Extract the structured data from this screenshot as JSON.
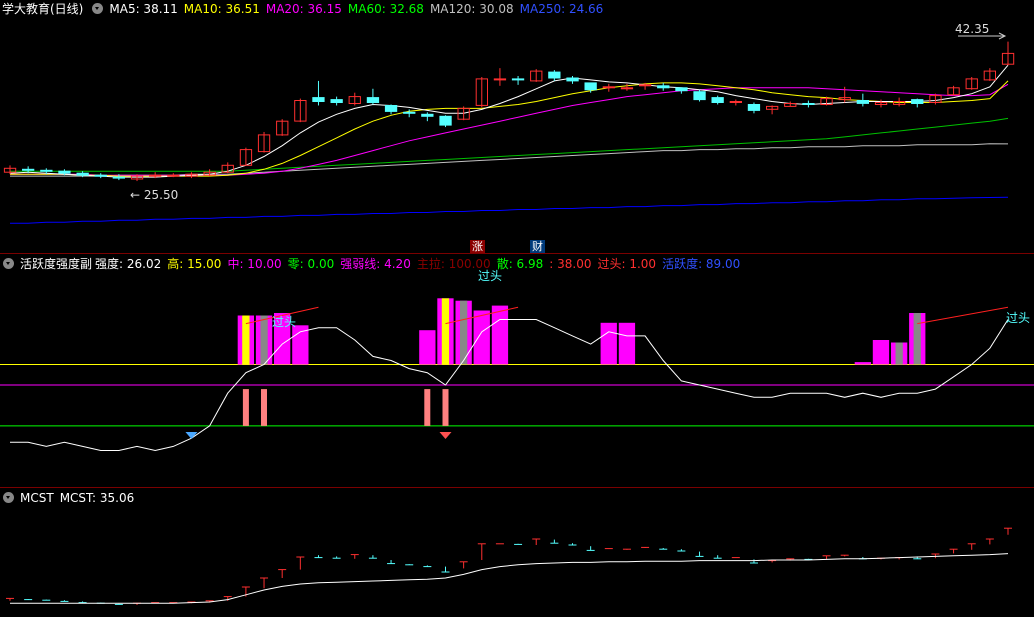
{
  "main": {
    "title": "学大教育(日线)",
    "ma": [
      {
        "label": "MA5: 38.11",
        "color": "#ffffff"
      },
      {
        "label": "MA10: 36.51",
        "color": "#ffff00"
      },
      {
        "label": "MA20: 36.15",
        "color": "#ff00ff"
      },
      {
        "label": "MA60: 32.68",
        "color": "#00ff00"
      },
      {
        "label": "MA120: 30.08",
        "color": "#c0c0c0"
      },
      {
        "label": "MA250: 24.66",
        "color": "#0000ff"
      }
    ],
    "high_label": "42.35",
    "low_label": "← 25.50",
    "badge_zhang": "涨",
    "badge_cai": "财"
  },
  "mid": {
    "title": "活跃度强度副",
    "fields": [
      {
        "label": "强度: 26.02",
        "color": "#ffffff"
      },
      {
        "label": "高: 15.00",
        "color": "#ffff00"
      },
      {
        "label": "中: 10.00",
        "color": "#ff00ff"
      },
      {
        "label": "零: 0.00",
        "color": "#00ff00"
      },
      {
        "label": "强弱线: 4.20",
        "color": "#ff00ff"
      },
      {
        "label": "主拉: 100.00",
        "color": "#8b0000"
      },
      {
        "label": "散: 6.98",
        "color": "#00ff00"
      },
      {
        "label": ": 38.00",
        "color": "#ff3030"
      },
      {
        "label": "过头: 1.00",
        "color": "#ff3030"
      },
      {
        "label": "活跃度: 89.00",
        "color": "#0000ff"
      }
    ],
    "guotou_labels": [
      "过头",
      "过头",
      "过头"
    ]
  },
  "bottom": {
    "title": "MCST",
    "value_label": "MCST: 35.06"
  },
  "colors": {
    "up": "#ff3030",
    "down": "#54ffff",
    "ma5": "#ffffff",
    "ma10": "#ffff00",
    "ma20": "#ff00ff",
    "ma60": "#00c000",
    "ma120": "#c0c0c0",
    "ma250": "#0000ff",
    "bar": "#ff00ff",
    "sep": "#7a0000"
  },
  "chart_data": {
    "type": "candlestick",
    "price_range": [
      25.5,
      42.35
    ],
    "candles": [
      [
        27.2,
        27.6,
        27.9,
        27.0
      ],
      [
        27.5,
        27.4,
        27.8,
        27.1
      ],
      [
        27.4,
        27.3,
        27.6,
        27.0
      ],
      [
        27.3,
        27.1,
        27.5,
        26.9
      ],
      [
        27.1,
        26.9,
        27.3,
        26.7
      ],
      [
        26.9,
        26.8,
        27.1,
        26.6
      ],
      [
        26.7,
        26.6,
        27.0,
        26.4
      ],
      [
        26.5,
        26.8,
        27.0,
        26.3
      ],
      [
        26.8,
        26.9,
        27.2,
        26.6
      ],
      [
        26.9,
        26.9,
        27.1,
        26.7
      ],
      [
        26.8,
        27.0,
        27.2,
        26.6
      ],
      [
        26.9,
        27.2,
        27.5,
        26.8
      ],
      [
        27.2,
        27.9,
        28.2,
        27.1
      ],
      [
        27.9,
        29.5,
        29.7,
        27.9
      ],
      [
        29.3,
        31.0,
        31.3,
        29.2
      ],
      [
        31.0,
        32.4,
        32.6,
        30.9
      ],
      [
        32.4,
        34.5,
        34.7,
        32.3
      ],
      [
        34.8,
        34.4,
        36.5,
        34.0
      ],
      [
        34.6,
        34.3,
        34.9,
        34.0
      ],
      [
        34.2,
        34.9,
        35.3,
        34.0
      ],
      [
        34.8,
        34.3,
        35.7,
        34.1
      ],
      [
        34.0,
        33.4,
        34.1,
        33.1
      ],
      [
        33.3,
        33.2,
        33.6,
        32.8
      ],
      [
        33.1,
        32.9,
        33.3,
        32.4
      ],
      [
        32.9,
        32.0,
        33.0,
        31.8
      ],
      [
        32.6,
        33.7,
        33.9,
        32.5
      ],
      [
        34.0,
        36.7,
        36.9,
        33.8
      ],
      [
        36.7,
        36.7,
        37.8,
        36.0
      ],
      [
        36.7,
        36.6,
        37.0,
        36.1
      ],
      [
        36.5,
        37.5,
        37.7,
        36.4
      ],
      [
        37.4,
        36.8,
        37.6,
        36.5
      ],
      [
        36.8,
        36.5,
        37.0,
        36.2
      ],
      [
        36.3,
        35.6,
        36.3,
        35.3
      ],
      [
        35.9,
        35.9,
        36.2,
        35.4
      ],
      [
        35.7,
        35.8,
        36.2,
        35.5
      ],
      [
        36.0,
        36.1,
        36.3,
        35.6
      ],
      [
        36.0,
        35.8,
        36.3,
        35.5
      ],
      [
        35.8,
        35.5,
        35.8,
        35.2
      ],
      [
        35.4,
        34.6,
        35.6,
        34.4
      ],
      [
        34.8,
        34.3,
        35.0,
        34.1
      ],
      [
        34.4,
        34.4,
        34.6,
        34.0
      ],
      [
        34.1,
        33.5,
        34.3,
        33.2
      ],
      [
        33.6,
        33.9,
        34.0,
        33.1
      ],
      [
        33.9,
        34.2,
        34.4,
        33.9
      ],
      [
        34.2,
        34.1,
        34.5,
        33.8
      ],
      [
        34.1,
        34.7,
        34.9,
        34.0
      ],
      [
        34.6,
        34.8,
        35.9,
        34.3
      ],
      [
        34.5,
        34.2,
        35.2,
        33.9
      ],
      [
        34.1,
        34.3,
        34.6,
        33.8
      ],
      [
        34.1,
        34.4,
        34.8,
        33.9
      ],
      [
        34.6,
        34.2,
        34.7,
        33.8
      ],
      [
        34.3,
        35.0,
        35.2,
        34.1
      ],
      [
        35.1,
        35.8,
        36.0,
        35.0
      ],
      [
        35.7,
        36.7,
        36.9,
        35.6
      ],
      [
        36.6,
        37.5,
        37.8,
        36.5
      ],
      [
        38.2,
        39.3,
        40.5,
        38.1
      ]
    ],
    "ma5": [
      27.1,
      27.2,
      27.1,
      27.0,
      26.9,
      26.8,
      26.7,
      26.7,
      26.7,
      26.8,
      26.9,
      27.0,
      27.3,
      27.9,
      28.8,
      29.9,
      31.2,
      32.3,
      33.1,
      33.7,
      34.1,
      34.0,
      33.8,
      33.5,
      33.2,
      33.2,
      33.6,
      34.2,
      34.9,
      35.7,
      36.5,
      36.8,
      36.6,
      36.4,
      36.3,
      36.1,
      35.9,
      35.8,
      35.6,
      35.4,
      35.0,
      34.7,
      34.4,
      34.2,
      34.1,
      34.2,
      34.3,
      34.4,
      34.4,
      34.4,
      34.4,
      34.5,
      34.8,
      35.2,
      35.9,
      38.1
    ],
    "ma10": [
      27.0,
      27.0,
      27.0,
      27.0,
      26.9,
      26.9,
      26.8,
      26.8,
      26.8,
      26.8,
      26.8,
      26.8,
      26.9,
      27.1,
      27.5,
      28.1,
      28.9,
      29.8,
      30.7,
      31.6,
      32.4,
      33.0,
      33.4,
      33.6,
      33.7,
      33.7,
      33.7,
      33.9,
      34.1,
      34.4,
      34.8,
      35.2,
      35.5,
      35.8,
      36.0,
      36.2,
      36.3,
      36.3,
      36.2,
      36.0,
      35.8,
      35.6,
      35.3,
      35.1,
      34.9,
      34.8,
      34.6,
      34.5,
      34.4,
      34.3,
      34.3,
      34.3,
      34.4,
      34.5,
      34.7,
      36.5
    ],
    "ma20": [
      27.0,
      27.0,
      27.0,
      27.0,
      27.0,
      26.9,
      26.9,
      26.9,
      26.9,
      26.9,
      26.9,
      26.9,
      26.9,
      27.0,
      27.1,
      27.3,
      27.6,
      28.0,
      28.4,
      28.9,
      29.4,
      29.9,
      30.4,
      30.8,
      31.2,
      31.6,
      32.0,
      32.4,
      32.8,
      33.2,
      33.6,
      34.0,
      34.3,
      34.6,
      34.9,
      35.1,
      35.3,
      35.5,
      35.6,
      35.7,
      35.8,
      35.8,
      35.8,
      35.8,
      35.8,
      35.7,
      35.6,
      35.5,
      35.4,
      35.3,
      35.2,
      35.1,
      35.0,
      35.0,
      35.1,
      36.15
    ],
    "ma60": [
      27.3,
      27.3,
      27.3,
      27.3,
      27.3,
      27.3,
      27.3,
      27.3,
      27.3,
      27.3,
      27.3,
      27.3,
      27.3,
      27.4,
      27.5,
      27.6,
      27.7,
      27.8,
      27.9,
      28.0,
      28.1,
      28.2,
      28.3,
      28.4,
      28.5,
      28.6,
      28.7,
      28.8,
      28.9,
      29.0,
      29.1,
      29.2,
      29.3,
      29.4,
      29.5,
      29.6,
      29.7,
      29.8,
      29.9,
      30.0,
      30.1,
      30.2,
      30.3,
      30.4,
      30.5,
      30.6,
      30.8,
      31.0,
      31.2,
      31.4,
      31.6,
      31.8,
      32.0,
      32.2,
      32.4,
      32.68
    ],
    "ma120": [
      26.8,
      26.8,
      26.8,
      26.8,
      26.8,
      26.8,
      26.9,
      26.9,
      26.9,
      26.9,
      27.0,
      27.0,
      27.0,
      27.1,
      27.2,
      27.3,
      27.4,
      27.5,
      27.6,
      27.7,
      27.8,
      27.9,
      28.0,
      28.1,
      28.2,
      28.3,
      28.4,
      28.5,
      28.6,
      28.7,
      28.8,
      28.9,
      29.0,
      29.1,
      29.2,
      29.3,
      29.4,
      29.4,
      29.5,
      29.5,
      29.6,
      29.6,
      29.7,
      29.7,
      29.8,
      29.8,
      29.8,
      29.9,
      29.9,
      29.9,
      30.0,
      30.0,
      30.0,
      30.0,
      30.1,
      30.08
    ],
    "ma250": [
      22.0,
      22.0,
      22.1,
      22.1,
      22.2,
      22.2,
      22.3,
      22.3,
      22.4,
      22.4,
      22.5,
      22.5,
      22.6,
      22.6,
      22.7,
      22.7,
      22.8,
      22.8,
      22.9,
      22.9,
      23.0,
      23.0,
      23.1,
      23.1,
      23.2,
      23.2,
      23.3,
      23.3,
      23.4,
      23.4,
      23.5,
      23.5,
      23.6,
      23.6,
      23.7,
      23.7,
      23.8,
      23.8,
      23.9,
      23.9,
      24.0,
      24.0,
      24.1,
      24.1,
      24.2,
      24.2,
      24.3,
      24.3,
      24.4,
      24.4,
      24.5,
      24.5,
      24.55,
      24.6,
      24.63,
      24.66
    ],
    "strength": [
      -4,
      -4,
      -5,
      -4,
      -5,
      -6,
      -6,
      -5,
      -6,
      -5,
      -3,
      0,
      8,
      13,
      15,
      20,
      23,
      24,
      24,
      21,
      17,
      16,
      14,
      13,
      10,
      16,
      23,
      26,
      26,
      26,
      24,
      22,
      20,
      23,
      22,
      22,
      16,
      11,
      10,
      9,
      8,
      7,
      7,
      8,
      8,
      8,
      7,
      8,
      7,
      8,
      8,
      9,
      12,
      15,
      19,
      26
    ],
    "active_bars": [
      {
        "i": 13,
        "h": 20,
        "c": "#ff00ff"
      },
      {
        "i": 14,
        "h": 20,
        "c": "#ff00ff"
      },
      {
        "i": 15,
        "h": 21,
        "c": "#ff00ff"
      },
      {
        "i": 16,
        "h": 16,
        "c": "#ff00ff"
      },
      {
        "i": 23,
        "h": 14,
        "c": "#ff00ff"
      },
      {
        "i": 24,
        "h": 27,
        "c": "#ff00ff"
      },
      {
        "i": 25,
        "h": 26,
        "c": "#ff00ff"
      },
      {
        "i": 26,
        "h": 22,
        "c": "#ff00ff"
      },
      {
        "i": 27,
        "h": 24,
        "c": "#ff00ff"
      },
      {
        "i": 33,
        "h": 17,
        "c": "#ff00ff"
      },
      {
        "i": 34,
        "h": 17,
        "c": "#ff00ff"
      },
      {
        "i": 47,
        "h": 1,
        "c": "#ff00ff"
      },
      {
        "i": 48,
        "h": 10,
        "c": "#ff00ff"
      },
      {
        "i": 49,
        "h": 9,
        "c": "#ff00ff"
      },
      {
        "i": 50,
        "h": 21,
        "c": "#ff00ff"
      }
    ],
    "inner_bars": [
      {
        "i": 13,
        "c": "#ffff00"
      },
      {
        "i": 14,
        "c": "#888888"
      },
      {
        "i": 24,
        "c": "#ffff00"
      },
      {
        "i": 25,
        "c": "#888888"
      },
      {
        "i": 49,
        "c": "#888888"
      },
      {
        "i": 50,
        "c": "#888888"
      }
    ],
    "pink_bars": [
      13,
      14,
      23,
      24
    ],
    "diamonds": [
      {
        "i": 10,
        "c": "#4aa8ff"
      },
      {
        "i": 24,
        "c": "#ff5050"
      }
    ],
    "mcst": [
      26.8,
      26.8,
      26.8,
      26.8,
      26.8,
      26.8,
      26.8,
      26.8,
      26.8,
      26.8,
      26.9,
      27.0,
      27.4,
      28.2,
      29.0,
      29.6,
      30.0,
      30.2,
      30.3,
      30.4,
      30.5,
      30.6,
      30.7,
      30.8,
      31.0,
      31.6,
      32.4,
      32.9,
      33.2,
      33.4,
      33.5,
      33.6,
      33.6,
      33.7,
      33.7,
      33.8,
      33.8,
      33.8,
      33.9,
      33.9,
      33.9,
      33.9,
      34.0,
      34.0,
      34.0,
      34.1,
      34.2,
      34.2,
      34.3,
      34.4,
      34.5,
      34.6,
      34.7,
      34.8,
      34.9,
      35.06
    ]
  }
}
